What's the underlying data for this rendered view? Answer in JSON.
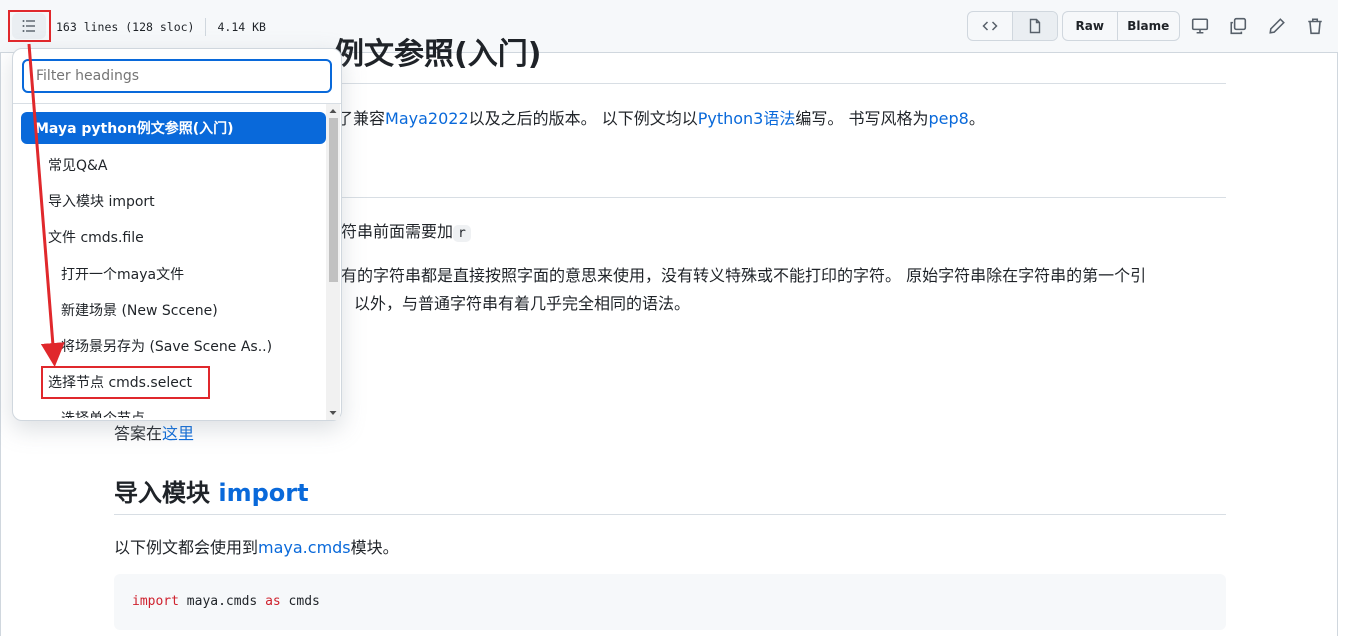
{
  "toolbar": {
    "lines": "163 lines (128 sloc)",
    "size": "4.14 KB",
    "raw_label": "Raw",
    "blame_label": "Blame"
  },
  "toc": {
    "filter_placeholder": "Filter headings",
    "items": [
      {
        "label": "Maya python例文参照(入门)",
        "level": 1,
        "active": true
      },
      {
        "label": "常见Q&A",
        "level": 2
      },
      {
        "label": "导入模块 import",
        "level": 2
      },
      {
        "label": "文件 cmds.file",
        "level": 2
      },
      {
        "label": "打开一个maya文件",
        "level": 3
      },
      {
        "label": "新建场景 (New Sccene)",
        "level": 3
      },
      {
        "label": "将场景另存为 (Save Scene As..)",
        "level": 3
      },
      {
        "label": "选择节点 cmds.select",
        "level": 2
      },
      {
        "label": "选择单个节点",
        "level": 3
      }
    ]
  },
  "content": {
    "title_partial": "例文参照(入门)",
    "intro_pre": "了兼容",
    "intro_link1": "Maya2022",
    "intro_mid": "以及之后的版本。 以下例文均以",
    "intro_link2": "Python3语法",
    "intro_mid2": "编写。 书写风格为",
    "intro_link3": "pep8",
    "intro_end": "。",
    "raw_note_pre": "符串前面需要加",
    "raw_note_code": "r",
    "raw_desc1": "有的字符串都是直接按照字面的意思来使用，没有转义特殊或不能打印的字符。 原始字符串除在字符串的第一个引",
    "raw_desc2": "以外，与普通字符串有着几乎完全相同的语法。",
    "answer_pre": "答案在",
    "answer_link": "这里",
    "h2_pre": "导入模块 ",
    "h2_link": "import",
    "import_pre": "以下例文都会使用到",
    "import_link": "maya.cmds",
    "import_post": "模块。",
    "code_kw1": "import",
    "code_mid": " maya.cmds ",
    "code_kw2": "as",
    "code_end": " cmds"
  },
  "colors": {
    "accent": "#0969da",
    "annotation": "#e0282c",
    "keyword": "#cf222e"
  }
}
